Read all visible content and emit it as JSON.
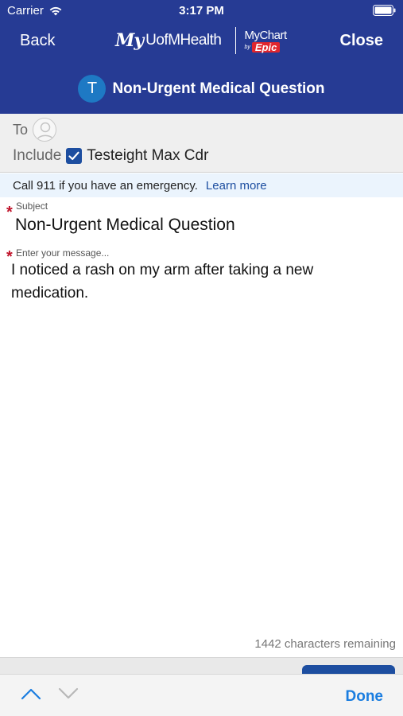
{
  "status_bar": {
    "carrier": "Carrier",
    "time": "3:17 PM"
  },
  "nav": {
    "back_label": "Back",
    "close_label": "Close",
    "logo": {
      "my": "My",
      "brand": "UofMHealth",
      "mychart": "MyChart",
      "by": "by",
      "epic": "Epic"
    }
  },
  "title": {
    "avatar_letter": "T",
    "text": "Non-Urgent Medical Question"
  },
  "recipients": {
    "to_label": "To",
    "include_label": "Include",
    "include_checked": true,
    "include_name": "Testeight Max Cdr"
  },
  "banner": {
    "text": "Call 911 if you have an emergency.",
    "link": "Learn more"
  },
  "subject": {
    "required_mark": "*",
    "label": "Subject",
    "value": "Non-Urgent Medical Question"
  },
  "message": {
    "required_mark": "*",
    "placeholder": "Enter your message...",
    "value": "I noticed a rash on my arm after taking a new medication."
  },
  "characters_remaining": "1442 characters remaining",
  "keyboard_toolbar": {
    "done_label": "Done"
  },
  "colors": {
    "header": "#263b94",
    "accent": "#1d4ea0",
    "required": "#c0142b",
    "done": "#1a7de0",
    "banner": "#ebf4fd"
  },
  "icons": [
    "wifi-icon",
    "battery-icon",
    "person-placeholder-icon",
    "checkmark-icon",
    "chevron-up-icon",
    "chevron-down-icon"
  ]
}
